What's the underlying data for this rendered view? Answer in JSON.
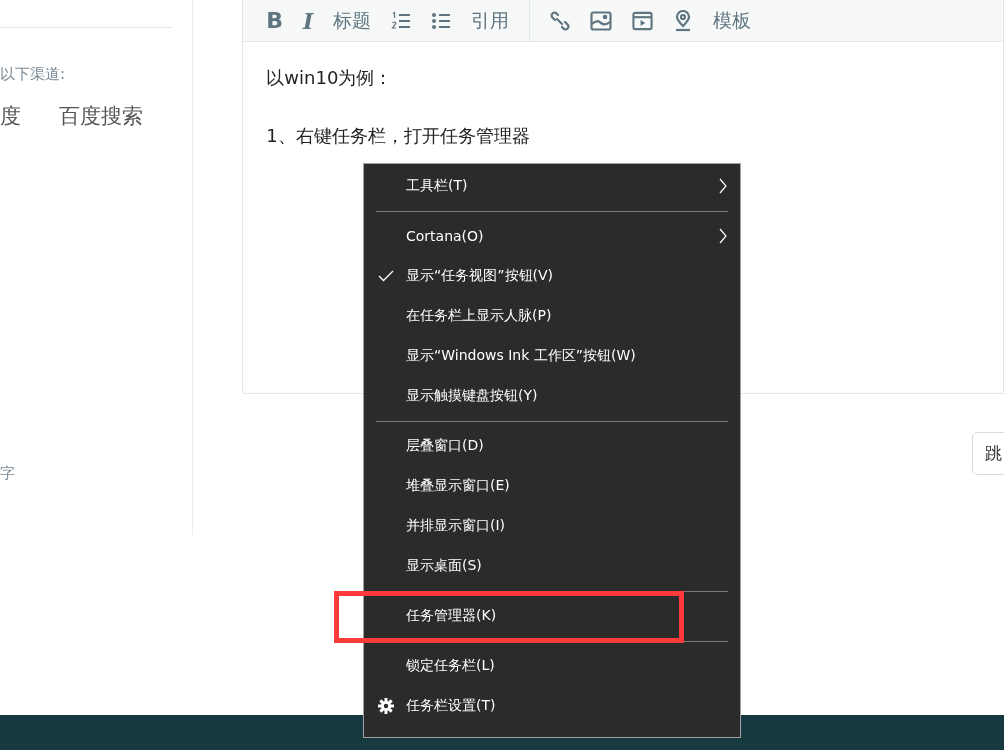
{
  "sidebar": {
    "hint": "以下渠道:",
    "links": [
      "度",
      "百度搜索"
    ],
    "note": "字"
  },
  "editor": {
    "toolbar": [
      {
        "kind": "bold",
        "label": "B"
      },
      {
        "kind": "italic",
        "label": "I"
      },
      {
        "kind": "text",
        "label": "标题"
      },
      {
        "kind": "ordered-list"
      },
      {
        "kind": "bullet-list"
      },
      {
        "kind": "text",
        "label": "引用"
      },
      {
        "kind": "divider"
      },
      {
        "kind": "link"
      },
      {
        "kind": "image"
      },
      {
        "kind": "video"
      },
      {
        "kind": "location"
      },
      {
        "kind": "text",
        "label": "模板"
      }
    ],
    "paragraphs": [
      "以win10为例：",
      "1、右键任务栏，打开任务管理器"
    ]
  },
  "side_button": {
    "label": "跳"
  },
  "context_menu": [
    {
      "kind": "submenu",
      "label": "工具栏(T)",
      "checked": false,
      "marked": false
    },
    {
      "kind": "separator"
    },
    {
      "kind": "submenu",
      "label": "Cortana(O)",
      "checked": false,
      "marked": false
    },
    {
      "kind": "item",
      "label": "显示“任务视图”按钮(V)",
      "checked": true,
      "marked": false
    },
    {
      "kind": "item",
      "label": "在任务栏上显示人脉(P)",
      "checked": false,
      "marked": false
    },
    {
      "kind": "item",
      "label": "显示“Windows Ink 工作区”按钮(W)",
      "checked": false,
      "marked": false
    },
    {
      "kind": "item",
      "label": "显示触摸键盘按钮(Y)",
      "checked": false,
      "marked": false
    },
    {
      "kind": "separator"
    },
    {
      "kind": "item",
      "label": "层叠窗口(D)",
      "checked": false,
      "marked": false
    },
    {
      "kind": "item",
      "label": "堆叠显示窗口(E)",
      "checked": false,
      "marked": false
    },
    {
      "kind": "item",
      "label": "并排显示窗口(I)",
      "checked": false,
      "marked": false
    },
    {
      "kind": "item",
      "label": "显示桌面(S)",
      "checked": false,
      "marked": false
    },
    {
      "kind": "separator"
    },
    {
      "kind": "item",
      "label": "任务管理器(K)",
      "checked": false,
      "marked": true
    },
    {
      "kind": "separator"
    },
    {
      "kind": "item",
      "label": "锁定任务栏(L)",
      "checked": false,
      "marked": false
    },
    {
      "kind": "settings",
      "label": "任务栏设置(T)",
      "checked": false,
      "marked": false
    }
  ]
}
